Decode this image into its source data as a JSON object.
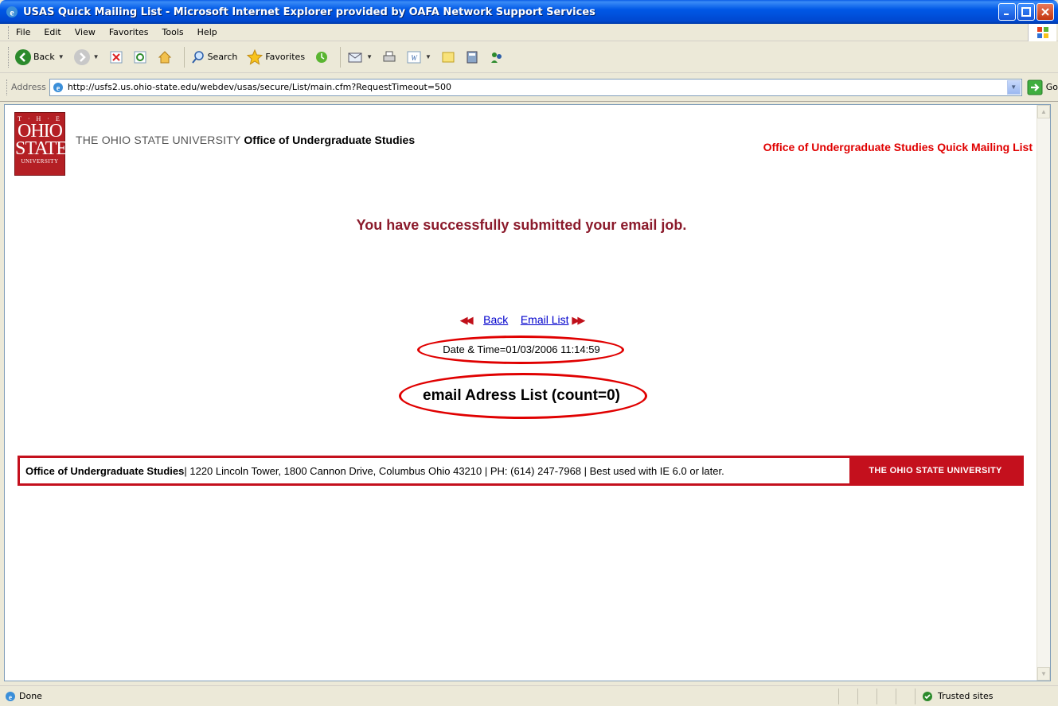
{
  "window": {
    "title": "USAS Quick Mailing List - Microsoft Internet Explorer provided by OAFA Network Support Services"
  },
  "menu": [
    "File",
    "Edit",
    "View",
    "Favorites",
    "Tools",
    "Help"
  ],
  "toolbar": {
    "back_label": "Back",
    "search_label": "Search",
    "favorites_label": "Favorites"
  },
  "address": {
    "label": "Address",
    "url": "http://usfs2.us.ohio-state.edu/webdev/usas/secure/List/main.cfm?RequestTimeout=500",
    "go_label": "Go"
  },
  "page": {
    "logo": {
      "line1": "T · H · E",
      "line2": "OHIO",
      "line3": "STATE",
      "line4": "UNIVERSITY"
    },
    "header_university": "THE OHIO STATE UNIVERSITY",
    "header_office": "Office of Undergraduate Studies",
    "header_right": "Office of Undergraduate Studies Quick Mailing List",
    "success_message": "You have successfully submitted your email job.",
    "nav_back": "Back",
    "nav_email_list": "Email List",
    "date_time": "Date & Time=01/03/2006 11:14:59",
    "count_label": "email Adress List (count=0)",
    "footer_office": "Office of Undergraduate Studies",
    "footer_details": " | 1220 Lincoln Tower, 1800 Cannon Drive, Columbus Ohio 43210 | PH: (614) 247-7968 | Best used with IE 6.0 or later.",
    "footer_brand": "THE OHIO STATE UNIVERSITY"
  },
  "status": {
    "left": "Done",
    "zone": "Trusted sites"
  },
  "colors": {
    "osu_red": "#c4101d",
    "accent_text": "#8b1a2b",
    "link": "#0000cc",
    "annotation": "#e00000"
  }
}
